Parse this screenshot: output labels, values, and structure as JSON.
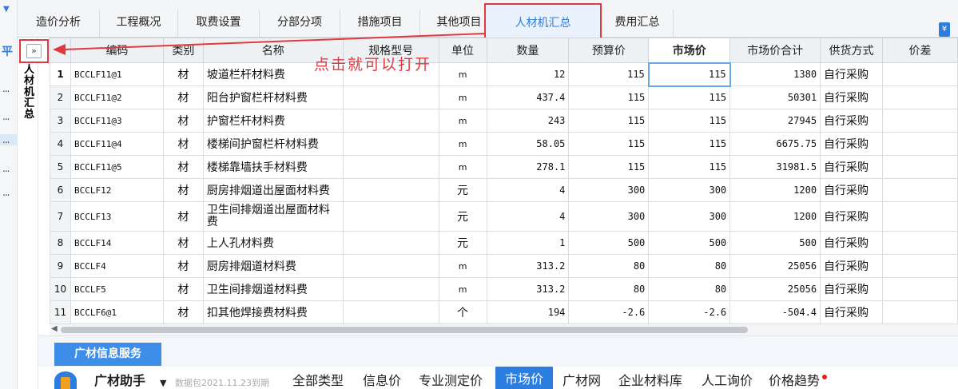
{
  "tabs": [
    {
      "label": "造价分析"
    },
    {
      "label": "工程概况"
    },
    {
      "label": "取费设置"
    },
    {
      "label": "分部分项"
    },
    {
      "label": "措施项目"
    },
    {
      "label": "其他项目"
    },
    {
      "label": "人材机汇总"
    },
    {
      "label": "费用汇总"
    }
  ],
  "active_tab": "人材机汇总",
  "sidebar": {
    "vertical_label": "人材机汇总",
    "expand_button": "»",
    "short_char": "平",
    "dots": "..."
  },
  "grid": {
    "columns": [
      "编码",
      "类别",
      "名称",
      "规格型号",
      "单位",
      "数量",
      "预算价",
      "市场价",
      "市场价合计",
      "供货方式",
      "价差"
    ],
    "rows": [
      {
        "idx": "1",
        "code": "BCCLF11@1",
        "type": "材",
        "name": "坡道栏杆材料费",
        "spec": "",
        "unit": "m",
        "qty": "12",
        "budget": "115",
        "market": "115",
        "total": "1380",
        "supply": "自行采购"
      },
      {
        "idx": "2",
        "code": "BCCLF11@2",
        "type": "材",
        "name": "阳台护窗栏杆材料费",
        "spec": "",
        "unit": "m",
        "qty": "437.4",
        "budget": "115",
        "market": "115",
        "total": "50301",
        "supply": "自行采购"
      },
      {
        "idx": "3",
        "code": "BCCLF11@3",
        "type": "材",
        "name": "护窗栏杆材料费",
        "spec": "",
        "unit": "m",
        "qty": "243",
        "budget": "115",
        "market": "115",
        "total": "27945",
        "supply": "自行采购"
      },
      {
        "idx": "4",
        "code": "BCCLF11@4",
        "type": "材",
        "name": "楼梯间护窗栏杆材料费",
        "spec": "",
        "unit": "m",
        "qty": "58.05",
        "budget": "115",
        "market": "115",
        "total": "6675.75",
        "supply": "自行采购"
      },
      {
        "idx": "5",
        "code": "BCCLF11@5",
        "type": "材",
        "name": "楼梯靠墙扶手材料费",
        "spec": "",
        "unit": "m",
        "qty": "278.1",
        "budget": "115",
        "market": "115",
        "total": "31981.5",
        "supply": "自行采购"
      },
      {
        "idx": "6",
        "code": "BCCLF12",
        "type": "材",
        "name": "厨房排烟道出屋面材料费",
        "spec": "",
        "unit": "元",
        "qty": "4",
        "budget": "300",
        "market": "300",
        "total": "1200",
        "supply": "自行采购"
      },
      {
        "idx": "7",
        "code": "BCCLF13",
        "type": "材",
        "name": "卫生间排烟道出屋面材料费",
        "spec": "",
        "unit": "元",
        "qty": "4",
        "budget": "300",
        "market": "300",
        "total": "1200",
        "supply": "自行采购"
      },
      {
        "idx": "8",
        "code": "BCCLF14",
        "type": "材",
        "name": "上人孔材料费",
        "spec": "",
        "unit": "元",
        "qty": "1",
        "budget": "500",
        "market": "500",
        "total": "500",
        "supply": "自行采购"
      },
      {
        "idx": "9",
        "code": "BCCLF4",
        "type": "材",
        "name": "厨房排烟道材料费",
        "spec": "",
        "unit": "m",
        "qty": "313.2",
        "budget": "80",
        "market": "80",
        "total": "25056",
        "supply": "自行采购"
      },
      {
        "idx": "10",
        "code": "BCCLF5",
        "type": "材",
        "name": "卫生间排烟道材料费",
        "spec": "",
        "unit": "m",
        "qty": "313.2",
        "budget": "80",
        "market": "80",
        "total": "25056",
        "supply": "自行采购"
      },
      {
        "idx": "11",
        "code": "BCCLF6@1",
        "type": "材",
        "name": "扣其他焊接费材料费",
        "spec": "",
        "unit": "个",
        "qty": "194",
        "budget": "-2.6",
        "market": "-2.6",
        "total": "-504.4",
        "supply": "自行采购"
      }
    ]
  },
  "annotation": {
    "text": "点击就可以打开",
    "color": "#e0393e"
  },
  "bottom": {
    "service_tab": "广材信息服务",
    "brand": "广材助手",
    "brand_caret": "▼",
    "package_note": "数据包2021.11.23到期",
    "tools": [
      "全部类型",
      "信息价",
      "专业测定价",
      "市场价",
      "广材网",
      "企业材料库",
      "人工询价",
      "价格趋势"
    ],
    "active_tool": "市场价"
  },
  "colors": {
    "accent": "#2b7de0",
    "highlight_border": "#e0393e",
    "header_bg": "#eef1f4"
  }
}
